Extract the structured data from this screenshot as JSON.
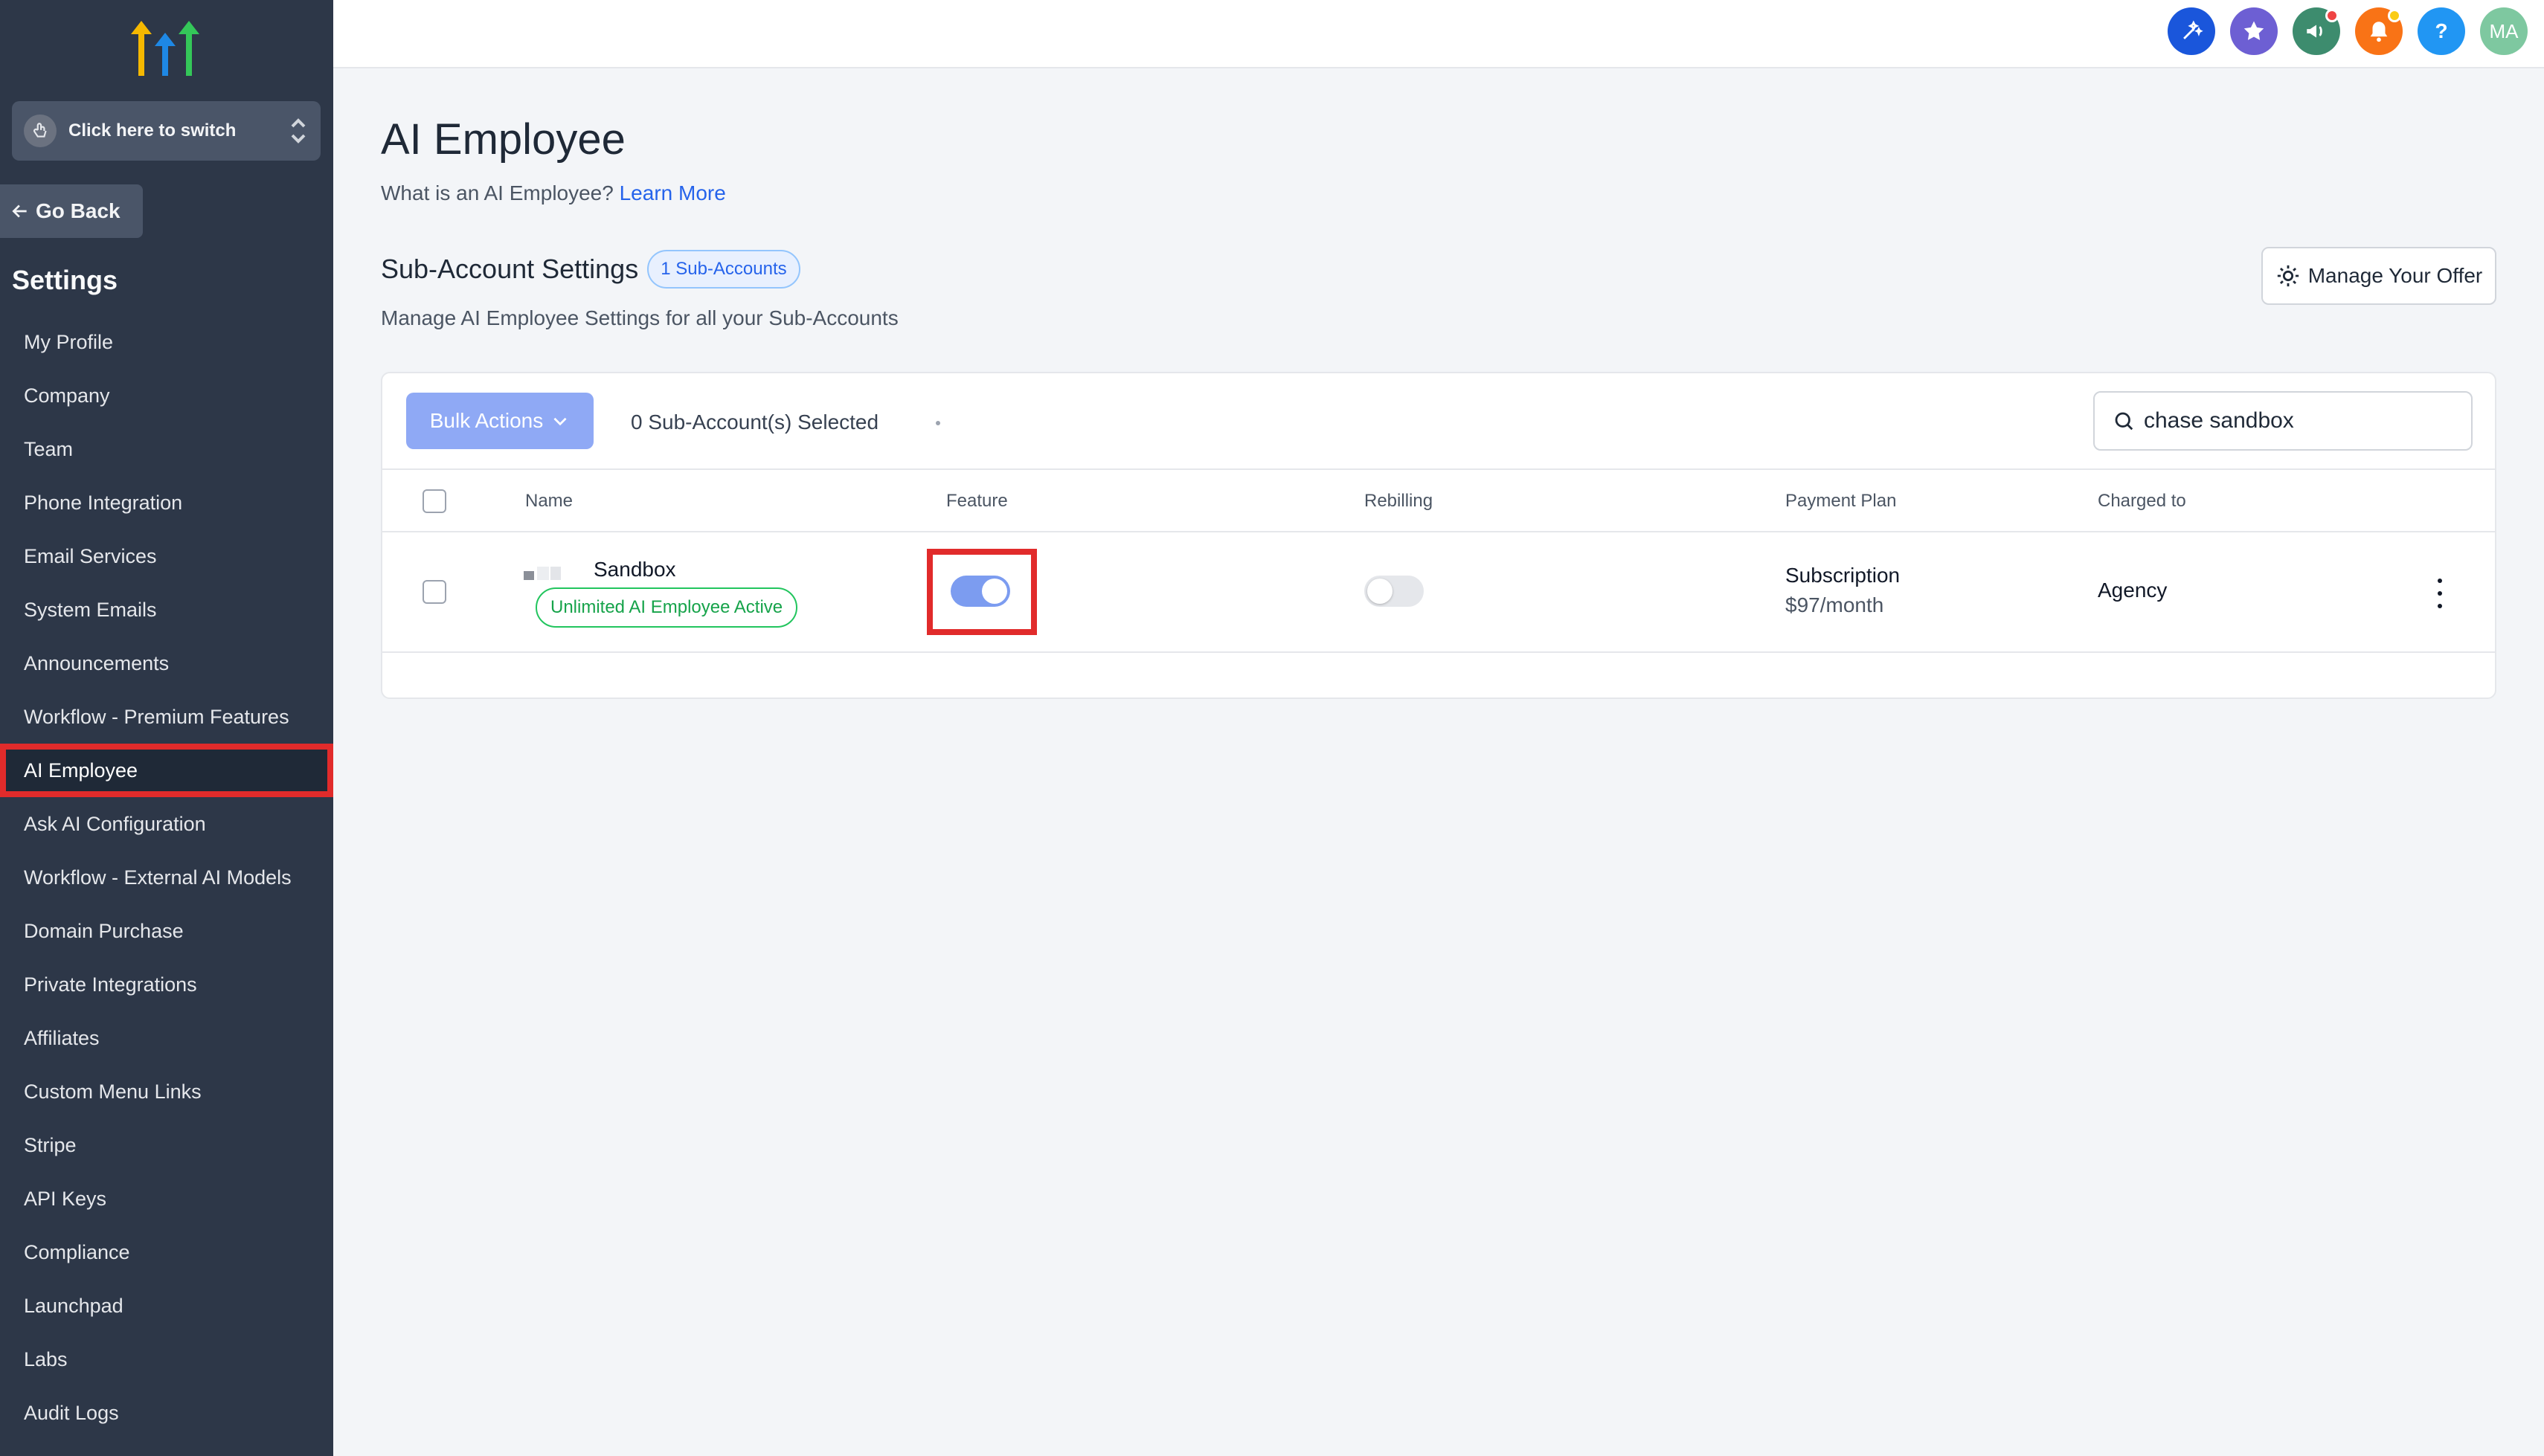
{
  "sidebar": {
    "switcher_label": "Click here to switch",
    "go_back_label": "Go Back",
    "settings_title": "Settings",
    "items": [
      {
        "label": "My Profile"
      },
      {
        "label": "Company"
      },
      {
        "label": "Team"
      },
      {
        "label": "Phone Integration"
      },
      {
        "label": "Email Services"
      },
      {
        "label": "System Emails"
      },
      {
        "label": "Announcements"
      },
      {
        "label": "Workflow - Premium Features"
      },
      {
        "label": "AI Employee",
        "active": true
      },
      {
        "label": "Ask AI Configuration"
      },
      {
        "label": "Workflow - External AI Models"
      },
      {
        "label": "Domain Purchase"
      },
      {
        "label": "Private Integrations"
      },
      {
        "label": "Affiliates"
      },
      {
        "label": "Custom Menu Links"
      },
      {
        "label": "Stripe"
      },
      {
        "label": "API Keys"
      },
      {
        "label": "Compliance"
      },
      {
        "label": "Launchpad"
      },
      {
        "label": "Labs"
      },
      {
        "label": "Audit Logs"
      }
    ]
  },
  "topbar": {
    "icons": [
      {
        "name": "ai-sparkle-icon",
        "color": "#1a56db"
      },
      {
        "name": "star-icon",
        "color": "#6d5fd3"
      },
      {
        "name": "megaphone-icon",
        "color": "#3d8c6e"
      },
      {
        "name": "bell-icon",
        "color": "#f97316"
      },
      {
        "name": "help-icon",
        "color": "#2196f3"
      },
      {
        "name": "user-avatar",
        "color": "#7ec8a0"
      }
    ],
    "help_glyph": "?",
    "avatar_initials": "MA"
  },
  "page": {
    "title": "AI Employee",
    "subtitle_text": "What is an AI Employee?",
    "learn_more": "Learn More",
    "section_title": "Sub-Account Settings",
    "sub_account_count": "1 Sub-Accounts",
    "section_desc": "Manage AI Employee Settings for all your Sub-Accounts",
    "manage_offer": "Manage Your Offer"
  },
  "table": {
    "bulk_actions": "Bulk Actions",
    "selected_text": "0 Sub-Account(s) Selected",
    "search_value": "chase sandbox",
    "headers": {
      "name": "Name",
      "feature": "Feature",
      "rebilling": "Rebilling",
      "payment_plan": "Payment Plan",
      "charged_to": "Charged to"
    },
    "rows": [
      {
        "name": "Sandbox",
        "status": "Unlimited AI Employee Active",
        "feature_on": true,
        "rebilling_on": false,
        "plan": "Subscription",
        "price": "$97/month",
        "charged_to": "Agency"
      }
    ]
  },
  "colors": {
    "sidebar_bg": "#2d3748",
    "accent": "#2563eb",
    "highlight": "#e12b2b",
    "success": "#16a34a"
  }
}
